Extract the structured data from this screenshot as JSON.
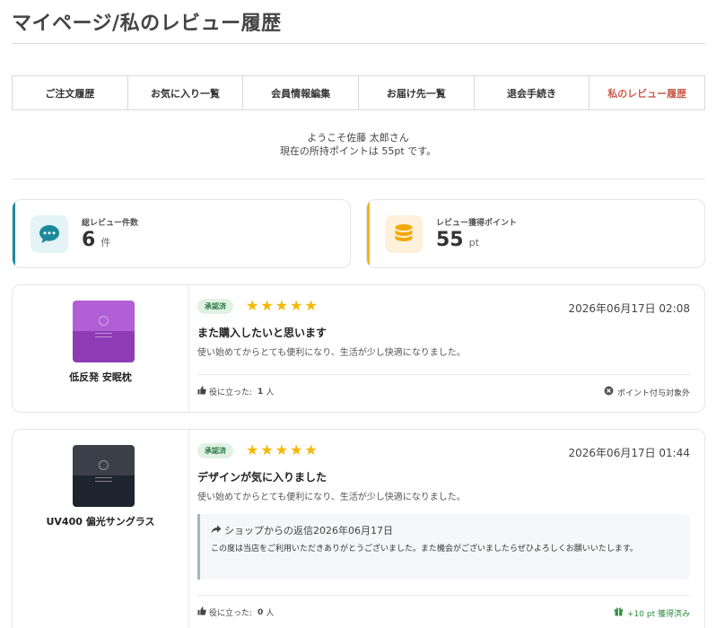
{
  "page": {
    "title": "マイページ/私のレビュー履歴"
  },
  "tabs": [
    {
      "label": "ご注文履歴"
    },
    {
      "label": "お気に入り一覧"
    },
    {
      "label": "会員情報編集"
    },
    {
      "label": "お届け先一覧"
    },
    {
      "label": "退会手続き"
    },
    {
      "label": "私のレビュー履歴",
      "active": true
    }
  ],
  "welcome": {
    "greeting": "ようこそ佐藤 太郎さん",
    "points": "現在の所持ポイントは 55pt です。"
  },
  "stats": {
    "total_reviews": {
      "label": "総レビュー件数",
      "value": "6",
      "unit": "件",
      "icon": "comment-icon",
      "color": "#1a8a99"
    },
    "review_points": {
      "label": "レビュー獲得ポイント",
      "value": "55",
      "unit": "pt",
      "icon": "coins-icon",
      "color": "#f2b700"
    }
  },
  "reviews": [
    {
      "product": "低反発 安眠枕",
      "image_colors": {
        "top": "#b15fd4",
        "bottom": "#8d3cb5"
      },
      "status": "承認済",
      "stars": "★★★★★",
      "rating": 5,
      "date": "2026年06月17日 02:08",
      "title": "また購入したいと思います",
      "text": "使い始めてからとても便利になり、生活が少し快適になりました。",
      "helpful_label": "役に立った:",
      "helpful_count": "1",
      "helpful_unit": "人",
      "points_note": "ポイント付与対象外"
    },
    {
      "product": "UV400 偏光サングラス",
      "image_colors": {
        "top": "#3a3f4a",
        "bottom": "#1e2430"
      },
      "status": "承認済",
      "stars": "★★★★★",
      "rating": 5,
      "date": "2026年06月17日 01:44",
      "title": "デザインが気に入りました",
      "text": "使い始めてからとても便利になり、生活が少し快適になりました。",
      "reply": {
        "head": "ショップからの返信2026年06月17日",
        "text": "この度は当店をご利用いただきありがとうございました。また機会がございましたらぜひよろしくお願いいたします。"
      },
      "helpful_label": "役に立った:",
      "helpful_count": "0",
      "helpful_unit": "人",
      "points_note": "+10 pt 獲得済み"
    }
  ]
}
